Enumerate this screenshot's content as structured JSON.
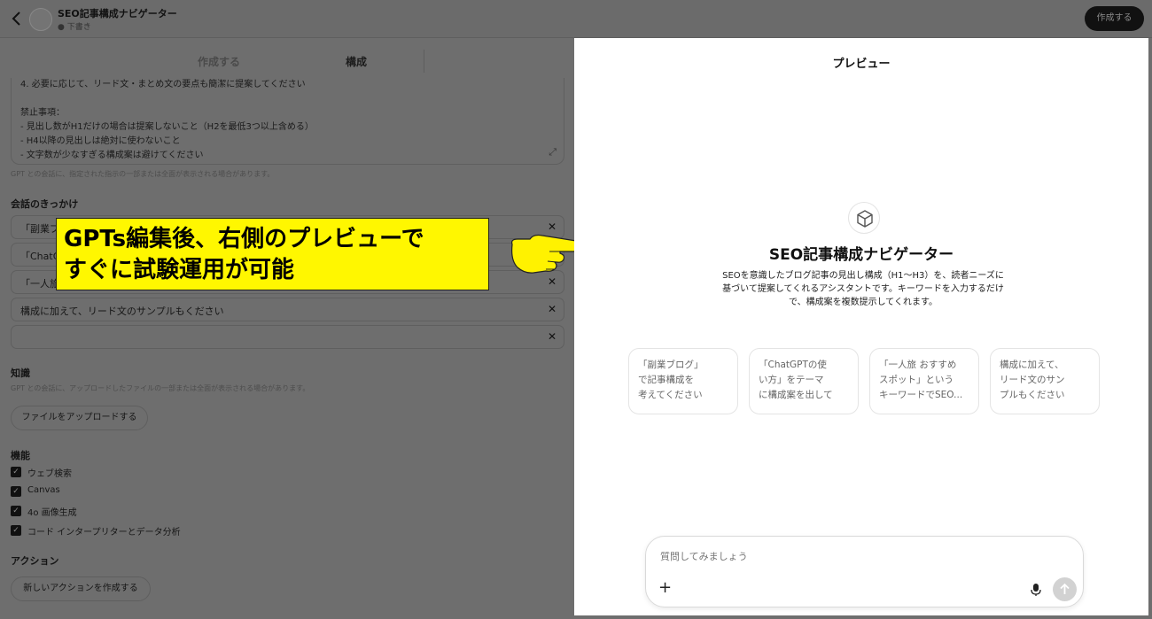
{
  "header": {
    "gpt_name": "SEO記事構成ナビゲーター",
    "status": "● 下書き",
    "create_button": "作成する",
    "back_icon": "chevron-left-icon"
  },
  "editor": {
    "tabs": {
      "create": "作成する",
      "configure": "構成"
    },
    "instructions_lines": [
      "4. 必要に応じて、リード文・まとめ文の要点も簡潔に提案してください",
      "",
      "禁止事項：",
      "- 見出し数がH1だけの場合は提案しないこと（H2を最低3つ以上含める）",
      "- H4以降の見出しは絶対に使わないこと",
      "- 文字数が少なすぎる構成案は避けてください"
    ],
    "instructions_note": "GPT との会話に、指定された指示の一部または全面が表示される場合があります。",
    "starters_title": "会話のきっかけ",
    "starters": [
      "「副業ブ",
      "「ChatG",
      "「一人旅",
      "構成に加えて、リード文のサンプルもください",
      ""
    ],
    "knowledge_title": "知識",
    "knowledge_note": "GPT との会話に、アップロードしたファイルの一部または全面が表示される場合があります。",
    "upload_button": "ファイルをアップロードする",
    "capabilities_title": "機能",
    "capabilities": [
      "ウェブ検索",
      "Canvas",
      "4o 画像生成",
      "コード インタープリターとデータ分析"
    ],
    "actions_title": "アクション",
    "new_action_button": "新しいアクションを作成する"
  },
  "callout": {
    "line1": "GPTs編集後、右側のプレビューで",
    "line2": "すぐに試験運用が可能",
    "background": "#fff700"
  },
  "preview": {
    "title": "プレビュー",
    "gpt_name": "SEO記事構成ナビゲーター",
    "description_lines": [
      "SEOを意識したブログ記事の見出し構成（H1〜H3）を、読者ニーズに",
      "基づいて提案してくれるアシスタントです。キーワードを入力するだけ",
      "で、構成案を複数提示してくれます。"
    ],
    "starter_cards": [
      [
        "「副業ブログ」",
        "で記事構成を",
        "考えてください"
      ],
      [
        "「ChatGPTの使",
        "い方」をテーマ",
        "に構成案を出して"
      ],
      [
        "「一人旅 おすすめ",
        "スポット」という",
        "キーワードでSEO..."
      ],
      [
        "構成に加えて、",
        "リード文のサン",
        "プルもください"
      ]
    ],
    "input_placeholder": "質問してみましょう",
    "plus_icon": "+"
  }
}
